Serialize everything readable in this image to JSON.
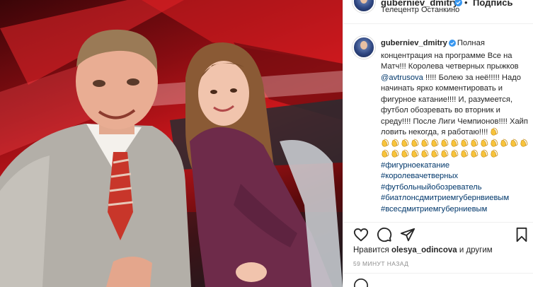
{
  "post": {
    "username": "guberniev_dmitry",
    "follow_label": "Подпись",
    "dot": "•",
    "location": "Телецентр Останкино"
  },
  "caption": {
    "username": "guberniev_dmitry",
    "text_1": "Полная концентрация на программе Все на Матч!!! Королева четверных прыжков ",
    "mention": "@avtrusova",
    "text_2": " !!!!! Болею за неё!!!!! Надо начинать ярко комментировать и фигурное катание!!!! И, разумеется, футбол обозревать во вторник и среду!!!! После Лиги Чемпионов!!!! Хайп ловить некогда, я работаю!!!! ",
    "clap_count_line1": 1,
    "clap_count_block": 27,
    "hashtags": [
      "#фигурноекатание",
      "#королевачетверных",
      "#футбольныйобозреватель",
      "#биатлонсдмитриемгубернвиевым",
      "#всесдмитриемгуберниевым"
    ]
  },
  "likes": {
    "prefix": "Нравится ",
    "user": "olesya_odincova",
    "suffix": " и другим"
  },
  "time_label": "59 МИНУТ НАЗАД",
  "icons": [
    "heart-icon",
    "comment-icon",
    "share-icon",
    "save-icon",
    "verified-icon",
    "clap-emoji",
    "smile-icon"
  ],
  "colors": {
    "verified": "#3897f0",
    "hashtag": "#00376b",
    "muted": "#8e8e8e",
    "studio_red": "#c8161b"
  }
}
